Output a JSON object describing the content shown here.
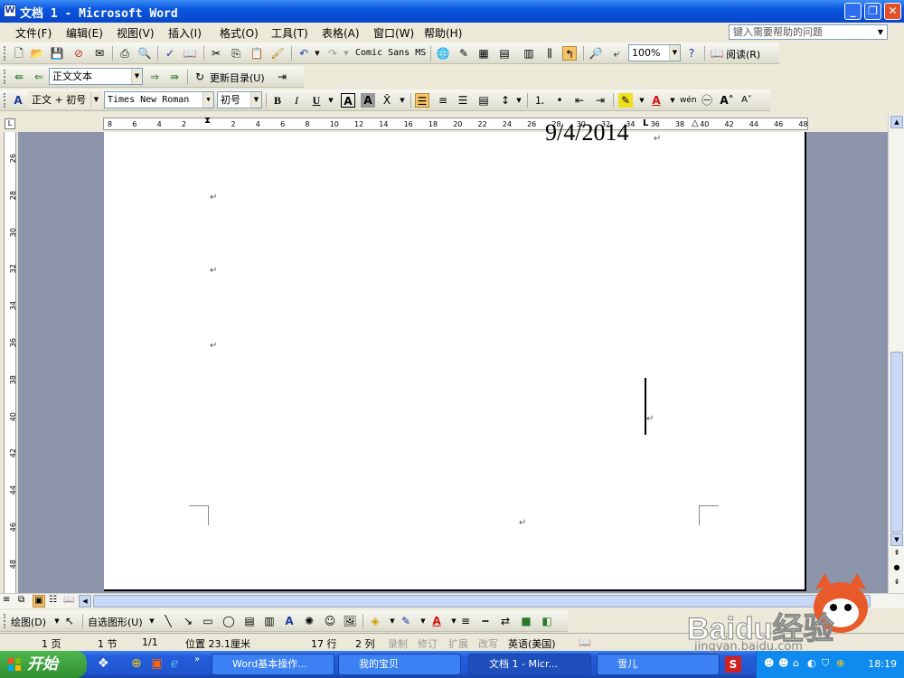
{
  "window": {
    "title": "文档 1 - Microsoft Word",
    "icon": "W"
  },
  "menu": {
    "items": [
      "文件(F)",
      "编辑(E)",
      "视图(V)",
      "插入(I)",
      "格式(O)",
      "工具(T)",
      "表格(A)",
      "窗口(W)",
      "帮助(H)"
    ],
    "help_placeholder": "键入需要帮助的问题"
  },
  "toolbar_standard": {
    "font_name": "Comic Sans MS",
    "zoom": "100%",
    "read_label": "阅读(R)"
  },
  "toolbar_outline": {
    "style_value": "正文文本",
    "update_toc_label": "更新目录(U)"
  },
  "toolbar_format": {
    "style": "正文 + 初号",
    "font": "Times New Roman",
    "size": "初号",
    "bold": "B",
    "italic": "I",
    "underline": "U",
    "char_border": "A",
    "char_shading": "A"
  },
  "ruler": {
    "h_ticks": [
      "8",
      "6",
      "4",
      "2",
      "2",
      "4",
      "6",
      "8",
      "10",
      "12",
      "14",
      "16",
      "18",
      "20",
      "22",
      "24",
      "26",
      "28",
      "30",
      "32",
      "34",
      "36",
      "38",
      "40",
      "42",
      "44",
      "46",
      "48"
    ],
    "v_ticks": [
      "26",
      "28",
      "30",
      "32",
      "34",
      "36",
      "38",
      "40",
      "42",
      "44",
      "46",
      "48"
    ]
  },
  "document": {
    "date_text": "9/4/2014",
    "para_mark": "↵"
  },
  "drawing_toolbar": {
    "draw_label": "绘图(D)",
    "autoshapes_label": "自选图形(U)"
  },
  "status": {
    "page": "1 页",
    "section": "1 节",
    "pages": "1/1",
    "position": "位置 23.1厘米",
    "line": "17 行",
    "column": "2 列",
    "rec": "录制",
    "trk": "修订",
    "ext": "扩展",
    "ovr": "改写",
    "lang": "英语(美国)"
  },
  "taskbar": {
    "start_label": "开始",
    "tasks": [
      "Word基本操作...",
      "我的宝贝",
      "文档 1 - Micr...",
      "雪儿"
    ],
    "clock": "18:19"
  },
  "watermark": {
    "text": "Baidu经验",
    "url": "jingyan.baidu.com"
  }
}
